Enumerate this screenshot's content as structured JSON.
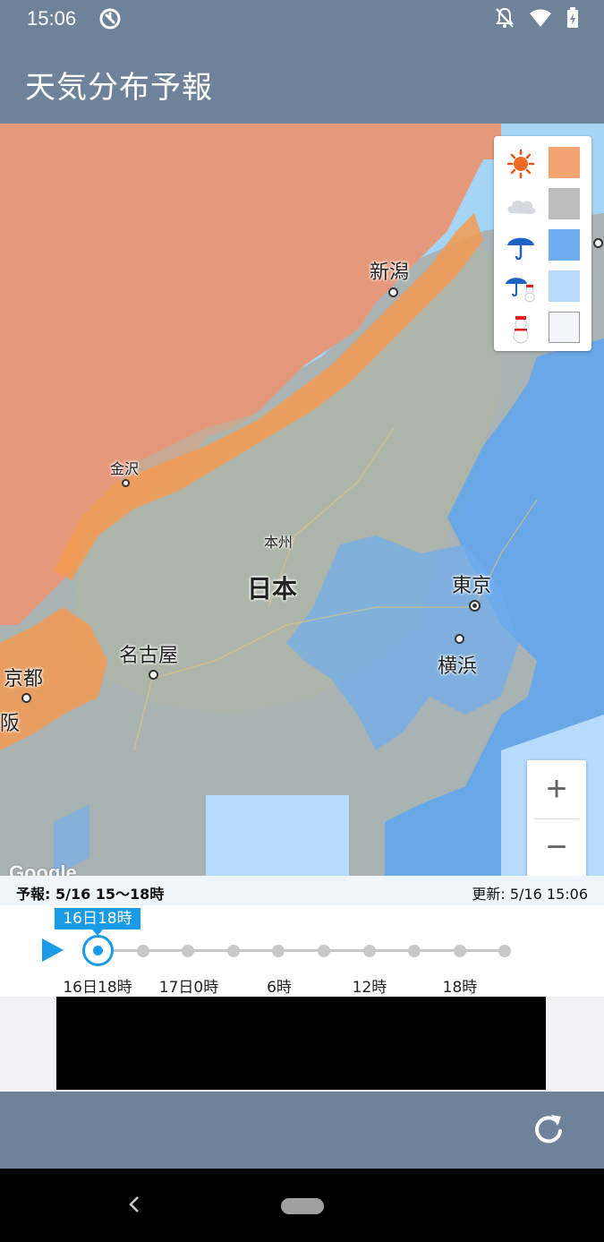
{
  "status_bar": {
    "time": "15:06",
    "left_icon": "data-saver-icon",
    "right_icons": [
      "notifications-off-icon",
      "wifi-icon",
      "battery-charging-icon"
    ]
  },
  "app_bar": {
    "title": "天気分布予報"
  },
  "map": {
    "places": {
      "niigata": "新潟",
      "kanazawa": "金沢",
      "honshu": "本州",
      "japan": "日本",
      "tokyo": "東京",
      "nagoya": "名古屋",
      "yokohama": "横浜",
      "kyoto": "京都",
      "osaka_partial": "阪"
    },
    "attribution": "Google",
    "colors": {
      "sea": "#a4d4f6",
      "sunny": "#f4a471",
      "cloudy": "#bdbdbd",
      "rain": "#6eaef0",
      "rain_snow": "#b7dbfb",
      "snow": "#f4f4fb"
    }
  },
  "legend": [
    {
      "icon": "sun-icon",
      "color": "#f4a471"
    },
    {
      "icon": "cloud-icon",
      "color": "#bdbdbd"
    },
    {
      "icon": "umbrella-icon",
      "color": "#6eaef0"
    },
    {
      "icon": "umbrella-snowman-icon",
      "color": "#b7dbfb"
    },
    {
      "icon": "snowman-icon",
      "color": "#f4f4fb"
    }
  ],
  "zoom": {
    "in_label": "+",
    "out_label": "−"
  },
  "info_bar": {
    "forecast": "予報: 5/16 15〜18時",
    "updated": "更新: 5/16 15:06"
  },
  "timeline": {
    "current_bubble": "16日18時",
    "labels": [
      "16日18時",
      "17日0時",
      "6時",
      "12時",
      "18時"
    ],
    "steps": 10,
    "current_index": 0
  },
  "bottom_bar": {
    "refresh_icon": "refresh-icon"
  },
  "nav_bar": {
    "back_icon": "back-icon",
    "home_icon": "home-pill-icon"
  }
}
